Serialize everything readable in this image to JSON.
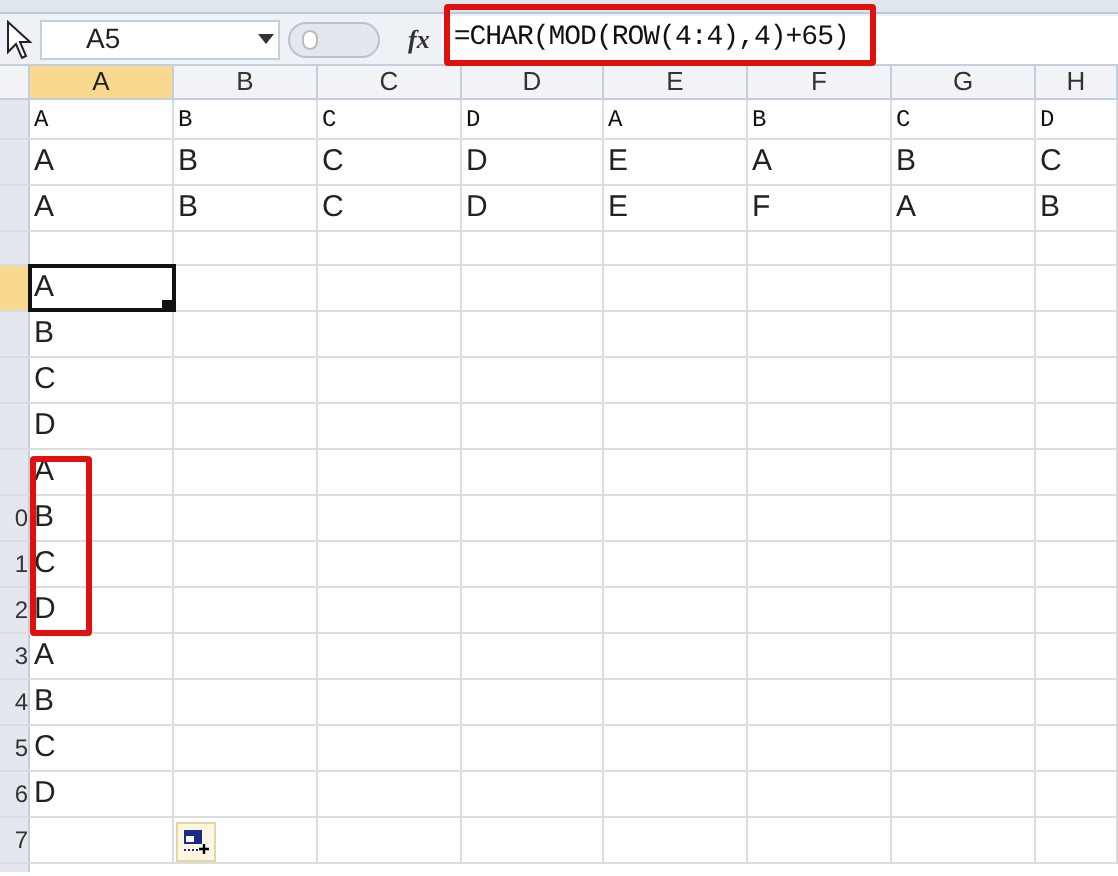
{
  "name_box": "A5",
  "formula": "=CHAR(MOD(ROW(4:4),4)+65)",
  "function_button": "fx",
  "columns": [
    {
      "label": "A",
      "selected": true
    },
    {
      "label": "B",
      "selected": false
    },
    {
      "label": "C",
      "selected": false
    },
    {
      "label": "D",
      "selected": false
    },
    {
      "label": "E",
      "selected": false
    },
    {
      "label": "F",
      "selected": false
    },
    {
      "label": "G",
      "selected": false
    },
    {
      "label": "H",
      "selected": false
    }
  ],
  "rows": [
    {
      "kind": "mono",
      "selected": false,
      "cells": [
        "A",
        "B",
        "C",
        "D",
        "A",
        "B",
        "C",
        "D"
      ]
    },
    {
      "kind": "text",
      "selected": false,
      "cells": [
        "A",
        "B",
        "C",
        "D",
        "E",
        "A",
        "B",
        "C"
      ]
    },
    {
      "kind": "text",
      "selected": false,
      "cells": [
        "A",
        "B",
        "C",
        "D",
        "E",
        "F",
        "A",
        "B"
      ]
    },
    {
      "kind": "short",
      "selected": false,
      "cells": []
    },
    {
      "kind": "text",
      "selected": true,
      "cells": [
        "A"
      ]
    },
    {
      "kind": "text",
      "selected": false,
      "cells": [
        "B"
      ]
    },
    {
      "kind": "text",
      "selected": false,
      "cells": [
        "C"
      ]
    },
    {
      "kind": "text",
      "selected": false,
      "cells": [
        "D"
      ]
    },
    {
      "kind": "text",
      "selected": false,
      "cells": [
        "A"
      ]
    },
    {
      "header": "0",
      "kind": "text",
      "selected": false,
      "cells": [
        "B"
      ]
    },
    {
      "header": "1",
      "kind": "text",
      "selected": false,
      "cells": [
        "C"
      ]
    },
    {
      "header": "2",
      "kind": "text",
      "selected": false,
      "cells": [
        "D"
      ]
    },
    {
      "header": "3",
      "kind": "text",
      "selected": false,
      "cells": [
        "A"
      ]
    },
    {
      "header": "4",
      "kind": "text",
      "selected": false,
      "cells": [
        "B"
      ]
    },
    {
      "header": "5",
      "kind": "text",
      "selected": false,
      "cells": [
        "C"
      ]
    },
    {
      "header": "6",
      "kind": "text",
      "selected": false,
      "cells": [
        "D"
      ]
    },
    {
      "header": "7",
      "kind": "text",
      "selected": false,
      "cells": []
    }
  ]
}
